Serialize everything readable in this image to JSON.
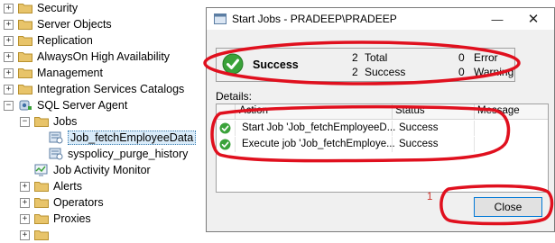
{
  "object_explorer": {
    "nodes": [
      {
        "label": "Security",
        "expander": "+",
        "icon": "folder-icon"
      },
      {
        "label": "Server Objects",
        "expander": "+",
        "icon": "folder-icon"
      },
      {
        "label": "Replication",
        "expander": "+",
        "icon": "folder-icon"
      },
      {
        "label": "AlwaysOn High Availability",
        "expander": "+",
        "icon": "folder-icon"
      },
      {
        "label": "Management",
        "expander": "+",
        "icon": "folder-icon"
      },
      {
        "label": "Integration Services Catalogs",
        "expander": "+",
        "icon": "folder-icon"
      },
      {
        "label": "SQL Server Agent",
        "expander": "−",
        "icon": "sql-agent-icon"
      },
      {
        "label": "Jobs",
        "expander": "−",
        "icon": "folder-icon"
      },
      {
        "label": "Job_fetchEmployeeData",
        "expander": "",
        "icon": "job-icon"
      },
      {
        "label": "syspolicy_purge_history",
        "expander": "",
        "icon": "job-icon"
      },
      {
        "label": "Job Activity Monitor",
        "expander": "",
        "icon": "activity-monitor-icon"
      },
      {
        "label": "Alerts",
        "expander": "+",
        "icon": "folder-icon"
      },
      {
        "label": "Operators",
        "expander": "+",
        "icon": "folder-icon"
      },
      {
        "label": "Proxies",
        "expander": "+",
        "icon": "folder-icon"
      }
    ]
  },
  "dialog": {
    "title": "Start Jobs -   PRADEEP\\PRADEEP",
    "minimize_glyph": "—",
    "close_glyph": "✕",
    "summary": {
      "state": "Success",
      "total_count": "2",
      "total_label": "Total",
      "success_count": "2",
      "success_label": "Success",
      "error_count": "0",
      "error_label": "Error",
      "warning_count": "0",
      "warning_label": "Warning"
    },
    "details_label": "Details:",
    "columns": [
      "Action",
      "Status",
      "Message"
    ],
    "rows": [
      {
        "action": "Start Job 'Job_fetchEmployeeD...",
        "status": "Success",
        "message": ""
      },
      {
        "action": "Execute job 'Job_fetchEmploye...",
        "status": "Success",
        "message": ""
      }
    ],
    "annotation_number": "1",
    "close_button": "Close"
  },
  "colors": {
    "highlight_red": "#e0101e",
    "success_green": "#3aa23a",
    "folder_yellow": "#e8c46a",
    "accent_blue": "#0078d7"
  }
}
